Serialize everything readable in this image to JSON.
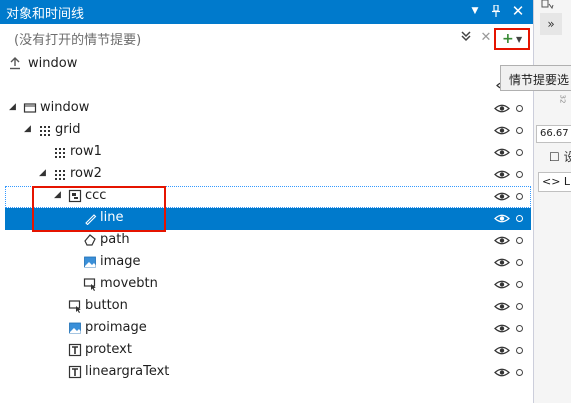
{
  "panel": {
    "title": "对象和时间线",
    "dropdown_glyph": "▼",
    "pin_glyph": "⊥",
    "close_glyph": "✕"
  },
  "storyboard": {
    "placeholder": "(没有打开的情节提要)",
    "expand_glyph": "⌄",
    "clear_glyph": "✕",
    "add_glyph": "+",
    "add_caret": "▼"
  },
  "scope": {
    "up_glyph": "⭱",
    "label": "window"
  },
  "tree": [
    {
      "label": "window",
      "icon": "window-icon",
      "depth": 0,
      "expanded": true,
      "selected": false
    },
    {
      "label": "grid",
      "icon": "grid-icon",
      "depth": 1,
      "expanded": true,
      "selected": false
    },
    {
      "label": "row1",
      "icon": "grid-icon",
      "depth": 2,
      "expanded": false,
      "selected": false
    },
    {
      "label": "row2",
      "icon": "grid-icon",
      "depth": 2,
      "expanded": true,
      "selected": false
    },
    {
      "label": "ccc",
      "icon": "canvas-icon",
      "depth": 3,
      "expanded": true,
      "selected": false
    },
    {
      "label": "line",
      "icon": "line-icon",
      "depth": 4,
      "expanded": false,
      "selected": true
    },
    {
      "label": "path",
      "icon": "path-icon",
      "depth": 4,
      "expanded": false,
      "selected": false
    },
    {
      "label": "image",
      "icon": "image-icon",
      "depth": 4,
      "expanded": false,
      "selected": false
    },
    {
      "label": "movebtn",
      "icon": "button-icon",
      "depth": 4,
      "expanded": false,
      "selected": false
    },
    {
      "label": "button",
      "icon": "button-icon",
      "depth": 3,
      "expanded": false,
      "selected": false
    },
    {
      "label": "proimage",
      "icon": "image-icon",
      "depth": 3,
      "expanded": false,
      "selected": false
    },
    {
      "label": "protext",
      "icon": "textblock-icon",
      "depth": 3,
      "expanded": false,
      "selected": false
    },
    {
      "label": "lineargraText",
      "icon": "textblock-icon",
      "depth": 3,
      "expanded": false,
      "selected": false
    }
  ],
  "tooltip": {
    "text": "情节提要选"
  },
  "right_panel": {
    "expand_glyph": "»",
    "number_field": "66.67",
    "item1": "☐ 设",
    "item2": "<> Lin",
    "small_text": "32"
  },
  "colors": {
    "accent": "#007acc",
    "highlight_box": "#e51400",
    "add_green": "#388a34"
  }
}
